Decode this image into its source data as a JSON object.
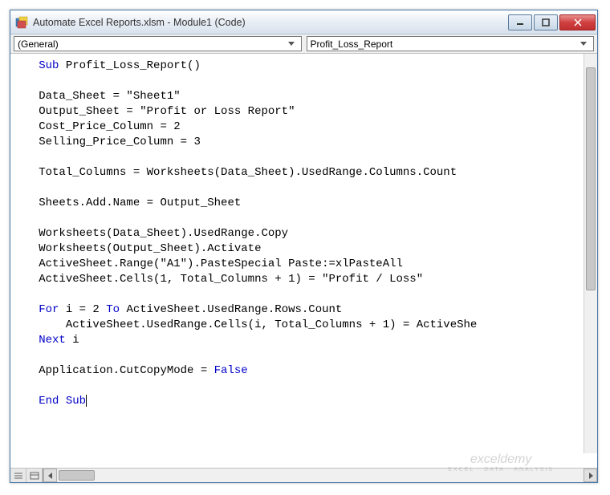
{
  "window": {
    "title": "Automate Excel Reports.xlsm - Module1 (Code)"
  },
  "dropdowns": {
    "left": "(General)",
    "right": "Profit_Loss_Report"
  },
  "code": {
    "l1_kw": "Sub ",
    "l1_rest": "Profit_Loss_Report()",
    "l3": "Data_Sheet = \"Sheet1\"",
    "l4": "Output_Sheet = \"Profit or Loss Report\"",
    "l5": "Cost_Price_Column = 2",
    "l6": "Selling_Price_Column = 3",
    "l8": "Total_Columns = Worksheets(Data_Sheet).UsedRange.Columns.Count",
    "l10": "Sheets.Add.Name = Output_Sheet",
    "l12": "Worksheets(Data_Sheet).UsedRange.Copy",
    "l13": "Worksheets(Output_Sheet).Activate",
    "l14": "ActiveSheet.Range(\"A1\").PasteSpecial Paste:=xlPasteAll",
    "l15": "ActiveSheet.Cells(1, Total_Columns + 1) = \"Profit / Loss\"",
    "l17_kw1": "For ",
    "l17_mid": "i = 2 ",
    "l17_kw2": "To ",
    "l17_rest": "ActiveSheet.UsedRange.Rows.Count",
    "l18": "    ActiveSheet.UsedRange.Cells(i, Total_Columns + 1) = ActiveShe",
    "l19_kw": "Next ",
    "l19_rest": "i",
    "l21_a": "Application.CutCopyMode = ",
    "l21_kw": "False",
    "l23_kw": "End Sub"
  },
  "watermark": {
    "main": "exceldemy",
    "sub": "EXCEL · DATA · ANALYSIS"
  }
}
